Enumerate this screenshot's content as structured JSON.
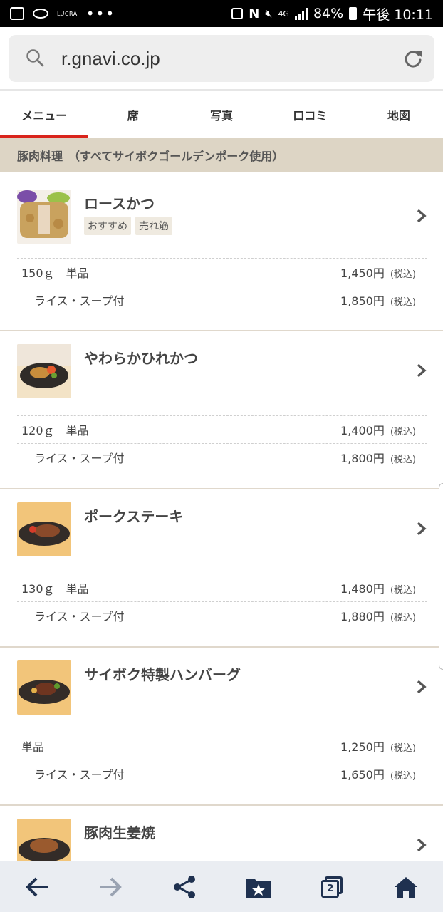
{
  "status_bar": {
    "carrier_text": "LUCRA",
    "dots": "•••",
    "network": "4G",
    "battery": "84%",
    "time": "午後 10:11"
  },
  "browser": {
    "url": "r.gnavi.co.jp",
    "tab_count": "2"
  },
  "tabs": [
    {
      "label": "メニュー",
      "active": true
    },
    {
      "label": "席"
    },
    {
      "label": "写真"
    },
    {
      "label": "口コミ"
    },
    {
      "label": "地図"
    }
  ],
  "category": {
    "title": "豚肉料理　（すべてサイボクゴールデンポーク使用）"
  },
  "items": [
    {
      "name": "ロースかつ",
      "tags": [
        "おすすめ",
        "売れ筋"
      ],
      "rows": [
        {
          "label": "150ｇ　単品",
          "price": "1,450円",
          "tax": "(税込)"
        },
        {
          "label": "ライス・スープ付",
          "price": "1,850円",
          "tax": "(税込)"
        }
      ]
    },
    {
      "name": "やわらかひれかつ",
      "tags": [],
      "rows": [
        {
          "label": "120ｇ　単品",
          "price": "1,400円",
          "tax": "(税込)"
        },
        {
          "label": "ライス・スープ付",
          "price": "1,800円",
          "tax": "(税込)"
        }
      ]
    },
    {
      "name": "ポークステーキ",
      "tags": [],
      "rows": [
        {
          "label": "130ｇ　単品",
          "price": "1,480円",
          "tax": "(税込)"
        },
        {
          "label": "ライス・スープ付",
          "price": "1,880円",
          "tax": "(税込)"
        }
      ]
    },
    {
      "name": "サイボク特製ハンバーグ",
      "tags": [],
      "rows": [
        {
          "label": "単品",
          "price": "1,250円",
          "tax": "(税込)"
        },
        {
          "label": "ライス・スープ付",
          "price": "1,650円",
          "tax": "(税込)"
        }
      ]
    },
    {
      "name": "豚肉生姜焼",
      "tags": [],
      "rows": []
    }
  ],
  "colors": {
    "accent": "#d9241b",
    "category_bg": "#ddd5c5",
    "nav_icon": "#1f3150"
  },
  "icons": {
    "search": "search-icon",
    "reload": "reload-icon",
    "chevron": "chevron-right-icon",
    "back": "back-arrow-icon",
    "forward": "forward-arrow-icon",
    "share": "share-icon",
    "bookmarks": "bookmark-folder-icon",
    "tabs": "tabs-icon",
    "home": "home-icon"
  }
}
